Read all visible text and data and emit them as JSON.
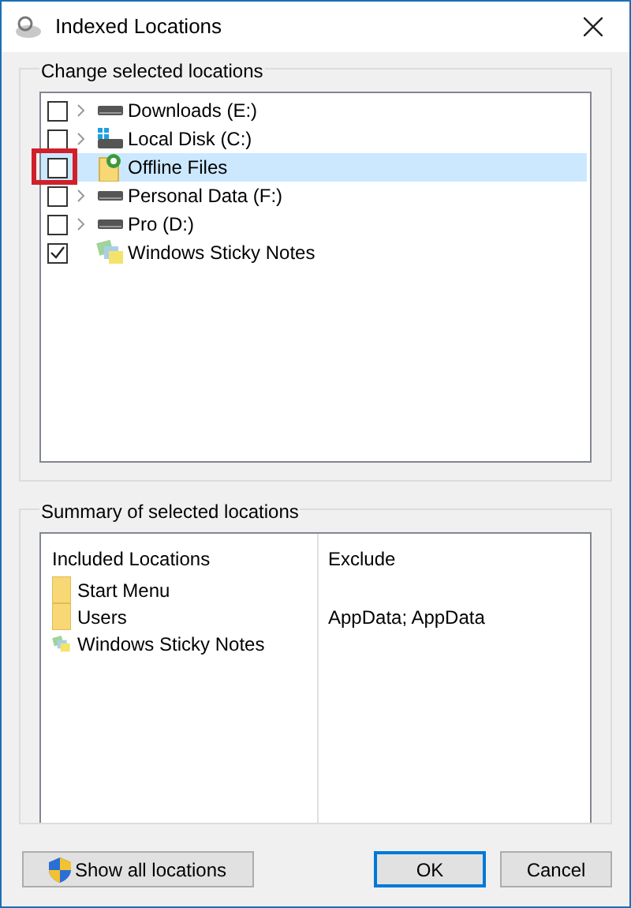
{
  "window": {
    "title": "Indexed Locations"
  },
  "change_group": {
    "title": "Change selected locations",
    "items": [
      {
        "label": "Downloads (E:)",
        "kind": "drive",
        "checked": false,
        "expandable": true,
        "selected": false,
        "highlighted": false
      },
      {
        "label": "Local Disk (C:)",
        "kind": "system-drive",
        "checked": false,
        "expandable": true,
        "selected": false,
        "highlighted": false
      },
      {
        "label": "Offline Files",
        "kind": "offline",
        "checked": false,
        "expandable": false,
        "selected": true,
        "highlighted": true
      },
      {
        "label": "Personal Data (F:)",
        "kind": "drive",
        "checked": false,
        "expandable": true,
        "selected": false,
        "highlighted": false
      },
      {
        "label": "Pro (D:)",
        "kind": "drive",
        "checked": false,
        "expandable": true,
        "selected": false,
        "highlighted": false
      },
      {
        "label": "Windows Sticky Notes",
        "kind": "sticky",
        "checked": true,
        "expandable": false,
        "selected": false,
        "highlighted": false
      }
    ]
  },
  "summary_group": {
    "title": "Summary of selected locations",
    "columns": [
      "Included Locations",
      "Exclude"
    ],
    "rows": [
      {
        "location": "Start Menu",
        "kind": "folder"
      },
      {
        "location": "Users",
        "kind": "folder",
        "exclude": "AppData; AppData"
      },
      {
        "location": "Windows Sticky Notes",
        "kind": "sticky"
      }
    ]
  },
  "buttons": [
    {
      "label": "Show all locations",
      "kind": "shield",
      "default": false
    },
    {
      "label": "OK",
      "kind": "plain",
      "default": true
    },
    {
      "label": "Cancel",
      "kind": "plain",
      "default": false
    }
  ]
}
